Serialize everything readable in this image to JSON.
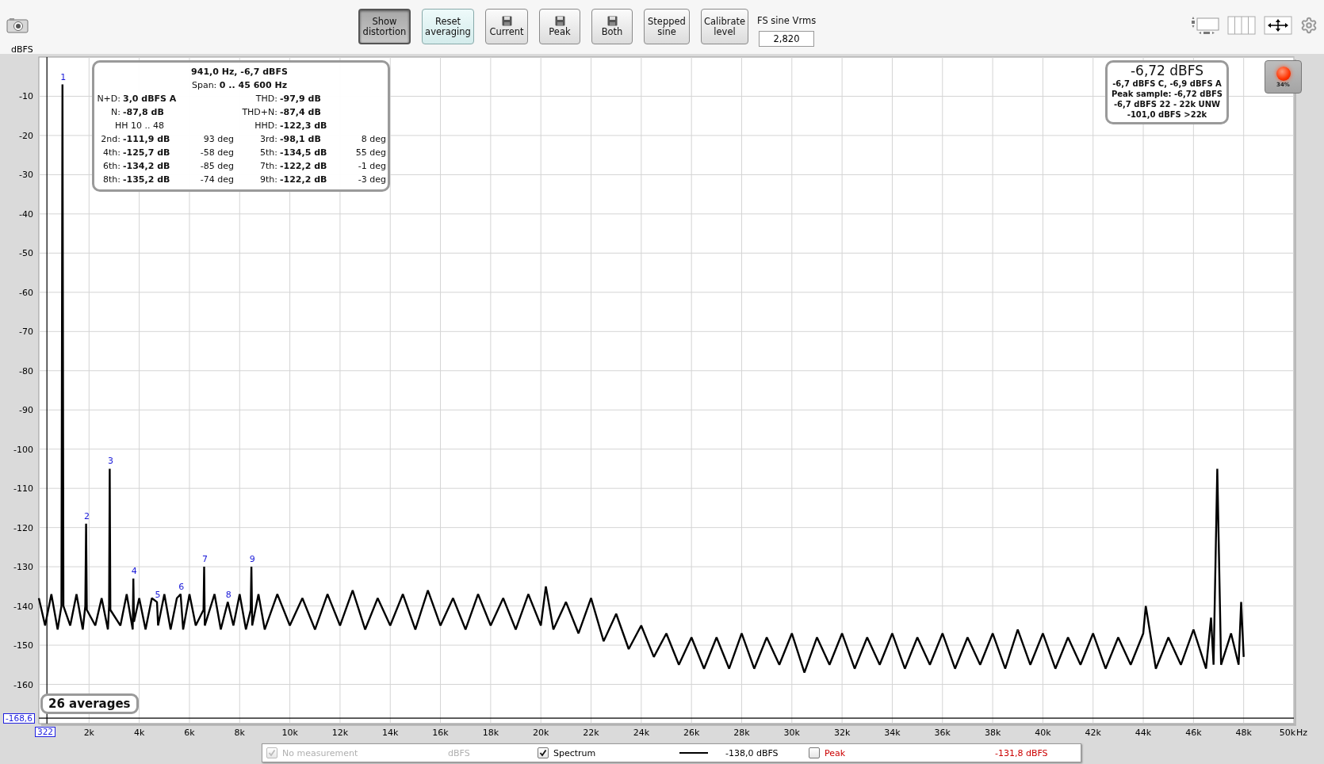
{
  "toolbar": {
    "buttons": [
      {
        "label": "Show distortion",
        "kind": "text",
        "pressed": true,
        "highlighted": false
      },
      {
        "label": "Reset averaging",
        "kind": "text",
        "pressed": false,
        "highlighted": true
      },
      {
        "label": "Current",
        "kind": "save",
        "pressed": false,
        "highlighted": false
      },
      {
        "label": "Peak",
        "kind": "save",
        "pressed": false,
        "highlighted": false
      },
      {
        "label": "Both",
        "kind": "save",
        "pressed": false,
        "highlighted": false
      },
      {
        "label": "Stepped sine",
        "kind": "text",
        "pressed": false,
        "highlighted": false
      },
      {
        "label": "Calibrate level",
        "kind": "text",
        "pressed": false,
        "highlighted": false
      }
    ],
    "fs_field": {
      "label": "FS sine Vrms",
      "value": "2,820"
    }
  },
  "chart": {
    "chart_data": {
      "type": "line",
      "ylabel": "dBFS",
      "xlabel": "Hz",
      "grid": true,
      "ref_lines": [
        {
          "axis": "y",
          "value": -168.6
        },
        {
          "axis": "x",
          "value": 322
        }
      ],
      "xlim": [
        0,
        50000
      ],
      "ylim": [
        -170,
        0
      ],
      "xticks": [
        {
          "value": 2000,
          "label": "2k"
        },
        {
          "value": 4000,
          "label": "4k"
        },
        {
          "value": 6000,
          "label": "6k"
        },
        {
          "value": 8000,
          "label": "8k"
        },
        {
          "value": 10000,
          "label": "10k"
        },
        {
          "value": 12000,
          "label": "12k"
        },
        {
          "value": 14000,
          "label": "14k"
        },
        {
          "value": 16000,
          "label": "16k"
        },
        {
          "value": 18000,
          "label": "18k"
        },
        {
          "value": 20000,
          "label": "20k"
        },
        {
          "value": 22000,
          "label": "22k"
        },
        {
          "value": 24000,
          "label": "24k"
        },
        {
          "value": 26000,
          "label": "26k"
        },
        {
          "value": 28000,
          "label": "28k"
        },
        {
          "value": 30000,
          "label": "30k"
        },
        {
          "value": 32000,
          "label": "32k"
        },
        {
          "value": 34000,
          "label": "34k"
        },
        {
          "value": 36000,
          "label": "36k"
        },
        {
          "value": 38000,
          "label": "38k"
        },
        {
          "value": 40000,
          "label": "40k"
        },
        {
          "value": 42000,
          "label": "42k"
        },
        {
          "value": 44000,
          "label": "44k"
        },
        {
          "value": 46000,
          "label": "46k"
        },
        {
          "value": 48000,
          "label": "48k"
        },
        {
          "value": 50000,
          "label": "50k"
        }
      ],
      "yticks": [
        {
          "value": -10,
          "label": "-10"
        },
        {
          "value": -20,
          "label": "-20"
        },
        {
          "value": -30,
          "label": "-30"
        },
        {
          "value": -40,
          "label": "-40"
        },
        {
          "value": -50,
          "label": "-50"
        },
        {
          "value": -60,
          "label": "-60"
        },
        {
          "value": -70,
          "label": "-70"
        },
        {
          "value": -80,
          "label": "-80"
        },
        {
          "value": -90,
          "label": "-90"
        },
        {
          "value": -100,
          "label": "-100"
        },
        {
          "value": -110,
          "label": "-110"
        },
        {
          "value": -120,
          "label": "-120"
        },
        {
          "value": -130,
          "label": "-130"
        },
        {
          "value": -140,
          "label": "-140"
        },
        {
          "value": -150,
          "label": "-150"
        },
        {
          "value": -160,
          "label": "-160"
        }
      ],
      "x": [
        0,
        250,
        500,
        750,
        900,
        941,
        980,
        1250,
        1500,
        1750,
        1850,
        1882,
        1910,
        2250,
        2500,
        2750,
        2800,
        2823,
        2850,
        3250,
        3500,
        3740,
        3764,
        3790,
        4000,
        4250,
        4500,
        4705,
        4750,
        5000,
        5250,
        5500,
        5646,
        5750,
        6000,
        6250,
        6560,
        6587,
        6610,
        7000,
        7250,
        7528,
        7750,
        8000,
        8250,
        8440,
        8469,
        8500,
        8750,
        9000,
        9500,
        10000,
        10500,
        11000,
        11500,
        12000,
        12500,
        13000,
        13500,
        14000,
        14500,
        15000,
        15500,
        16000,
        16500,
        17000,
        17500,
        18000,
        18500,
        19000,
        19500,
        20000,
        20200,
        20500,
        21000,
        21500,
        22000,
        22500,
        23000,
        23500,
        24000,
        24500,
        25000,
        25500,
        26000,
        26500,
        27000,
        27500,
        28000,
        28500,
        29000,
        29500,
        30000,
        30500,
        31000,
        31500,
        32000,
        32500,
        33000,
        33500,
        34000,
        34500,
        35000,
        35500,
        36000,
        36500,
        37000,
        37500,
        38000,
        38500,
        39000,
        39500,
        40000,
        40500,
        41000,
        41500,
        42000,
        42500,
        43000,
        43500,
        44000,
        44100,
        44500,
        45000,
        45500,
        46000,
        46500,
        46700,
        46800,
        46950,
        47100,
        47500,
        47800,
        47900,
        48000
      ],
      "series": [
        {
          "name": "Spectrum",
          "color": "#000000",
          "values": [
            -138,
            -145,
            -137,
            -146,
            -140,
            -7,
            -140,
            -145,
            -137,
            -146,
            -140,
            -119,
            -141,
            -145,
            -138,
            -146,
            -140,
            -105,
            -141,
            -145,
            -137,
            -146,
            -133,
            -144,
            -138,
            -146,
            -138,
            -139,
            -145,
            -137,
            -146,
            -138,
            -137,
            -146,
            -137,
            -145,
            -141,
            -130,
            -145,
            -137,
            -146,
            -139,
            -145,
            -137,
            -146,
            -141,
            -130,
            -145,
            -137,
            -146,
            -137,
            -145,
            -138,
            -146,
            -137,
            -145,
            -136,
            -146,
            -138,
            -145,
            -137,
            -146,
            -136,
            -145,
            -138,
            -146,
            -137,
            -145,
            -138,
            -146,
            -137,
            -145,
            -135,
            -146,
            -139,
            -147,
            -138,
            -149,
            -142,
            -151,
            -145,
            -153,
            -147,
            -155,
            -148,
            -156,
            -148,
            -156,
            -147,
            -156,
            -148,
            -155,
            -147,
            -157,
            -148,
            -155,
            -147,
            -156,
            -148,
            -155,
            -147,
            -156,
            -148,
            -155,
            -147,
            -156,
            -148,
            -155,
            -147,
            -156,
            -146,
            -155,
            -147,
            -156,
            -148,
            -155,
            -147,
            -156,
            -148,
            -155,
            -147,
            -140,
            -156,
            -148,
            -155,
            -146,
            -156,
            -143,
            -155,
            -105,
            -155,
            -147,
            -155,
            -139,
            -153
          ]
        }
      ],
      "annotations": [
        {
          "text": "1",
          "x": 941,
          "y": -7
        },
        {
          "text": "2",
          "x": 1882,
          "y": -119
        },
        {
          "text": "3",
          "x": 2823,
          "y": -105
        },
        {
          "text": "4",
          "x": 3764,
          "y": -133
        },
        {
          "text": "5",
          "x": 4705,
          "y": -139
        },
        {
          "text": "6",
          "x": 5646,
          "y": -137
        },
        {
          "text": "7",
          "x": 6587,
          "y": -130
        },
        {
          "text": "8",
          "x": 7528,
          "y": -139
        },
        {
          "text": "9",
          "x": 8469,
          "y": -130
        }
      ]
    },
    "cursor": {
      "y_readout": "-168,6",
      "x_readout": "322"
    },
    "averages": "26 averages"
  },
  "distortion_panel": {
    "headline": "941,0 Hz, -6,7 dBFS",
    "span": "Span: **0 .. 45 600 Hz**",
    "summary": [
      {
        "left_label": "N+D:",
        "left_value": "3,0 dBFS A",
        "right_label": "THD:",
        "right_value": "-97,9 dB"
      },
      {
        "left_label": "N:",
        "left_value": "-87,8 dB",
        "right_label": "THD+N:",
        "right_value": "-87,4 dB"
      },
      {
        "left_text": "HH 10 .. 48",
        "right_label": "HHD:",
        "right_value": "-122,3 dB"
      }
    ],
    "harmonics": [
      {
        "label": "2nd:",
        "value": "-111,9 dB",
        "phase": "93 deg"
      },
      {
        "label": "3rd:",
        "value": "-98,1 dB",
        "phase": "8 deg"
      },
      {
        "label": "4th:",
        "value": "-125,7 dB",
        "phase": "-58 deg"
      },
      {
        "label": "5th:",
        "value": "-134,5 dB",
        "phase": "55 deg"
      },
      {
        "label": "6th:",
        "value": "-134,2 dB",
        "phase": "-85 deg"
      },
      {
        "label": "7th:",
        "value": "-122,2 dB",
        "phase": "-1 deg"
      },
      {
        "label": "8th:",
        "value": "-135,2 dB",
        "phase": "-74 deg"
      },
      {
        "label": "9th:",
        "value": "-122,2 dB",
        "phase": "-3 deg"
      }
    ]
  },
  "level_box": {
    "main": "-6,72 dBFS",
    "lines": [
      "-6,7 dBFS C, -6,9 dBFS A",
      "Peak sample: -6,72 dBFS",
      "-6,7 dBFS 22 - 22k UNW",
      "-101,0 dBFS >22k"
    ]
  },
  "record_button": {
    "label": "34%"
  },
  "legend": [
    {
      "label": "No measurement",
      "reading": "dBFS",
      "checked": true,
      "disabled": true
    },
    {
      "kind": "series",
      "reading": "-138,0 dBFS",
      "checked": true,
      "disabled": false,
      "color": "#000000"
    },
    {
      "label": "Peak",
      "reading": "-131,8 dBFS",
      "checked": false,
      "disabled": false,
      "color": "#cc0000"
    }
  ]
}
